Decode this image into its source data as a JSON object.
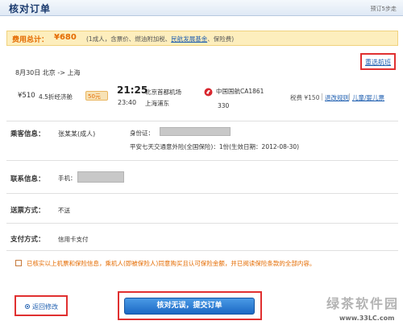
{
  "header": {
    "title": "核对订单",
    "step_text": "预订5步走"
  },
  "total": {
    "label": "费用总计：",
    "amount": "¥680",
    "note_prefix": "(1成人，含票价、燃油附加税、",
    "note_link": "民航发展基金",
    "note_suffix": "、保险费)"
  },
  "flight": {
    "date_route": "8月30日  北京 -> 上海",
    "rebook_label": "重选航班",
    "price": "¥510",
    "discount": "4.5折经济舱",
    "badge": "50元",
    "dep_time": "21:25",
    "dep_airport": "北京首都机场",
    "arr_time": "23:40",
    "arr_airport": "上海浦东",
    "airline": "中国国航CA1861",
    "flight_no": "330",
    "tax": "税费 ¥150",
    "rules_link": "退改规则",
    "child_link": "儿童/婴儿票"
  },
  "passenger": {
    "label": "乘客信息：",
    "name": "张某某(成人)",
    "id_label": "身份证：",
    "insurance": "平安七天交通意外险(全国保险)：1份(生效日期：2012-08-30)"
  },
  "contact": {
    "label": "联系信息：",
    "phone_label": "手机："
  },
  "delivery": {
    "label": "送票方式：",
    "value": "不送"
  },
  "payment": {
    "label": "支付方式：",
    "value": "信用卡支付"
  },
  "agreement": {
    "text": "已核实以上机票和保险信息，乘机人(即被保险人)同意购买且认可保险金额，并已阅读保险条款的全部内容。"
  },
  "actions": {
    "back_label": "返回修改",
    "submit_label": "核对无误，提交订单"
  },
  "watermark": {
    "brand": "绿茶软件园",
    "url": "www.33LC.com"
  },
  "colors": {
    "accent_orange": "#e46b00",
    "link_blue": "#1f5fb0",
    "highlight_red": "#e03030",
    "button_blue": "#1c68c4"
  }
}
